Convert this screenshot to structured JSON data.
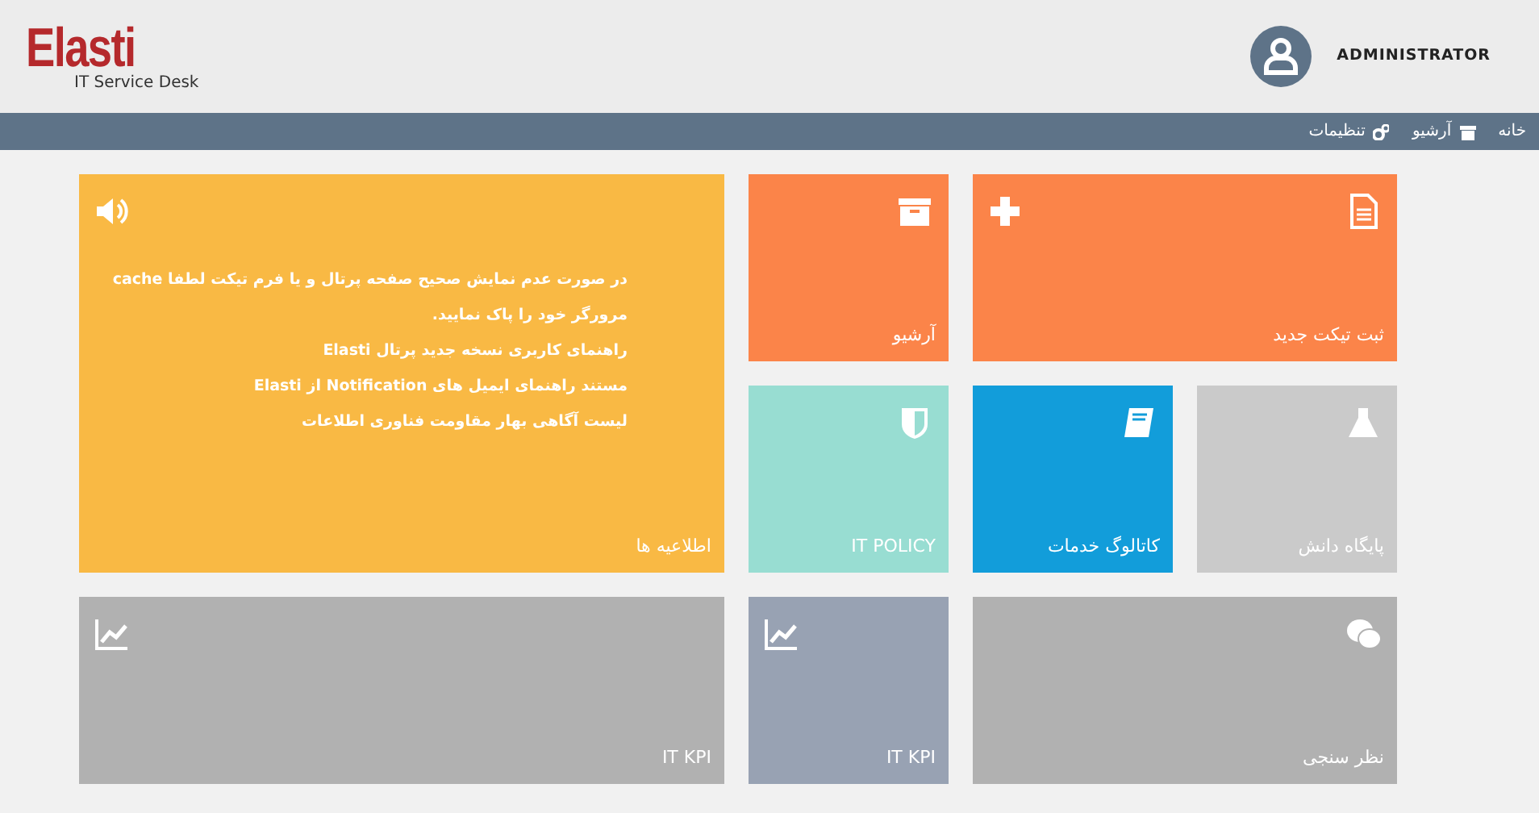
{
  "header": {
    "logo": "Elasti",
    "subtitle": "IT Service Desk",
    "user": "ADMINISTRATOR"
  },
  "nav": [
    {
      "label": "خانه"
    },
    {
      "label": "آرشیو"
    },
    {
      "label": "تنظیمات"
    }
  ],
  "tiles": [
    {
      "kind": "wide",
      "label": "ثبت تیکت جدید",
      "color": "#fb8449"
    },
    {
      "kind": "small",
      "label": "آرشیو",
      "color": "#fb8449"
    },
    {
      "kind": "small",
      "label": "پایگاه دانش",
      "color": "#cacaca"
    },
    {
      "kind": "small",
      "label": "کاتالوگ خدمات",
      "color": "#129dda"
    },
    {
      "kind": "small",
      "label": "IT POLICY",
      "color": "#98ddd2"
    },
    {
      "kind": "announce",
      "label": "اطلاعیه ها",
      "color": "#f9b944",
      "lines": [
        "در صورت عدم نمایش صحیح صفحه پرتال و یا فرم تیکت لطفا cache",
        "مرورگر خود را پاک نمایید.",
        "راهنمای کاربری نسخه جدید پرتال Elasti",
        "مستند راهنمای ایمیل های Notification از Elasti",
        "لیست آگاهی بهار مقاومت فناوری اطلاعات"
      ]
    },
    {
      "kind": "wide",
      "label": "نظر سنجی",
      "color": "#b1b1b1"
    },
    {
      "kind": "small",
      "label": "IT KPI",
      "color": "#98a2b3"
    },
    {
      "kind": "big",
      "label": "IT KPI",
      "color": "#b1b1b1"
    }
  ]
}
